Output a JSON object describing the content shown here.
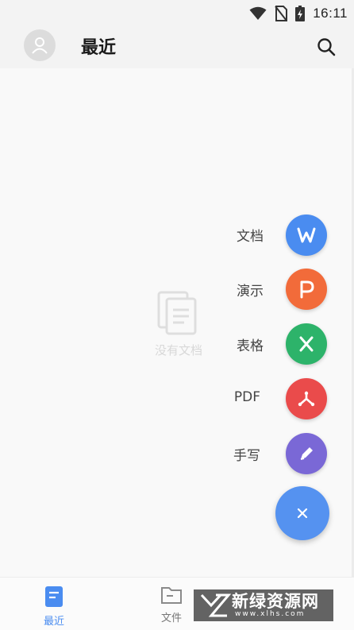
{
  "status_bar": {
    "time": "16:11",
    "icons": [
      "wifi-icon",
      "no-sim-icon",
      "battery-charging-icon"
    ]
  },
  "header": {
    "title": "最近",
    "avatar_icon": "user-avatar-icon",
    "search_icon": "search-icon"
  },
  "empty_state": {
    "icon": "documents-icon",
    "text": "没有文档"
  },
  "fab_menu": {
    "items": [
      {
        "label": "文档",
        "icon": "word-w-icon",
        "color": "#4a8cf0"
      },
      {
        "label": "演示",
        "icon": "presentation-p-icon",
        "color": "#f26b3a"
      },
      {
        "label": "表格",
        "icon": "spreadsheet-x-icon",
        "color": "#2db36a"
      },
      {
        "label": "PDF",
        "icon": "pdf-icon",
        "color": "#ea4b4b"
      },
      {
        "label": "手写",
        "icon": "pen-icon",
        "color": "#7a68d6"
      }
    ],
    "close_icon": "close-icon",
    "main_color": "#5592f0"
  },
  "bottom_nav": {
    "items": [
      {
        "label": "最近",
        "icon": "recent-doc-icon",
        "active": true
      },
      {
        "label": "文件",
        "icon": "folder-icon",
        "active": false
      }
    ],
    "active_color": "#4a8cf0"
  },
  "watermark": {
    "text": "新绿资源网",
    "sub": "www.xlhs.com"
  }
}
